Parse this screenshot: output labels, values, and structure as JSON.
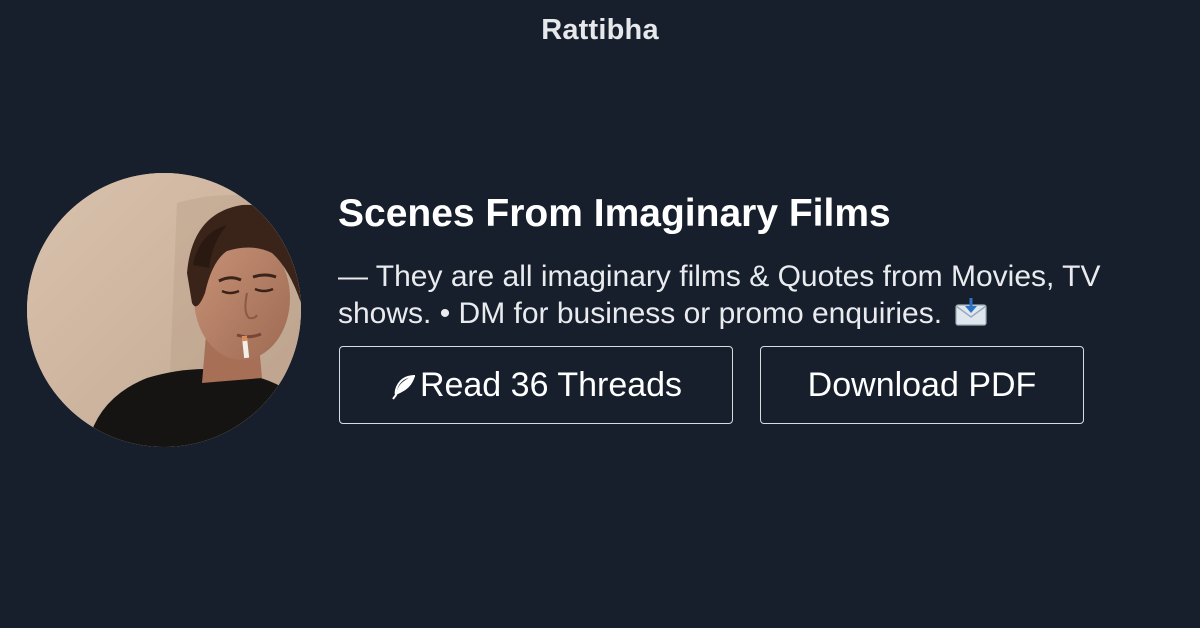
{
  "header": {
    "brand": "Rattibha"
  },
  "profile": {
    "avatar_alt": "profile photo",
    "title": "Scenes From Imaginary Films",
    "bio": "— They are all imaginary films & Quotes from Movies, TV shows. • DM for business or promo enquiries.",
    "bio_icon": "envelope-with-arrow-icon"
  },
  "actions": {
    "read_label": "Read 36 Threads",
    "read_icon": "feather-icon",
    "download_label": "Download PDF"
  },
  "colors": {
    "background": "#161f2b",
    "text": "#ffffff",
    "button_border": "#d8dce1"
  }
}
